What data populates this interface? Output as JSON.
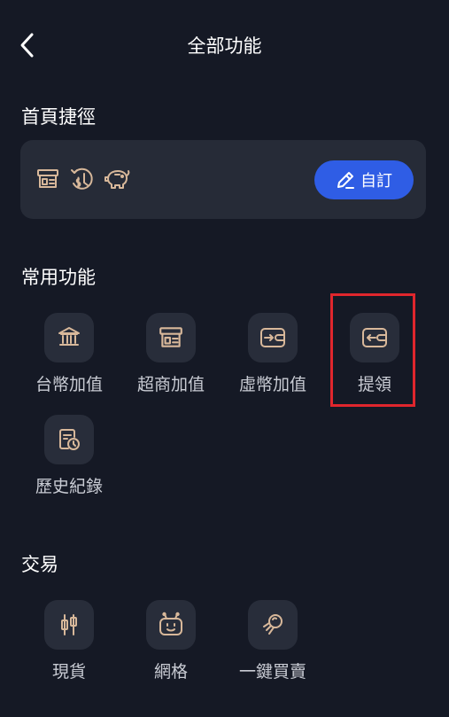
{
  "header": {
    "title": "全部功能"
  },
  "shortcuts": {
    "title": "首頁捷徑",
    "icons": [
      "store-icon",
      "dollar-history-icon",
      "piggy-bank-icon"
    ],
    "edit_label": "自訂"
  },
  "common": {
    "title": "常用功能",
    "items": [
      {
        "label": "台幣加值",
        "icon": "bank-icon"
      },
      {
        "label": "超商加值",
        "icon": "store-icon"
      },
      {
        "label": "虛幣加值",
        "icon": "wallet-in-icon"
      },
      {
        "label": "提領",
        "icon": "wallet-out-icon"
      },
      {
        "label": "歷史紀錄",
        "icon": "history-doc-icon"
      }
    ]
  },
  "trade": {
    "title": "交易",
    "items": [
      {
        "label": "現貨",
        "icon": "candlestick-icon"
      },
      {
        "label": "網格",
        "icon": "robot-icon"
      },
      {
        "label": "一鍵買賣",
        "icon": "rocket-icon"
      }
    ]
  },
  "colors": {
    "background": "#151925",
    "card": "#262b37",
    "tile": "#282d3a",
    "icon": "#d8b89a",
    "accent": "#2f5de5",
    "highlight": "#e0262d"
  }
}
